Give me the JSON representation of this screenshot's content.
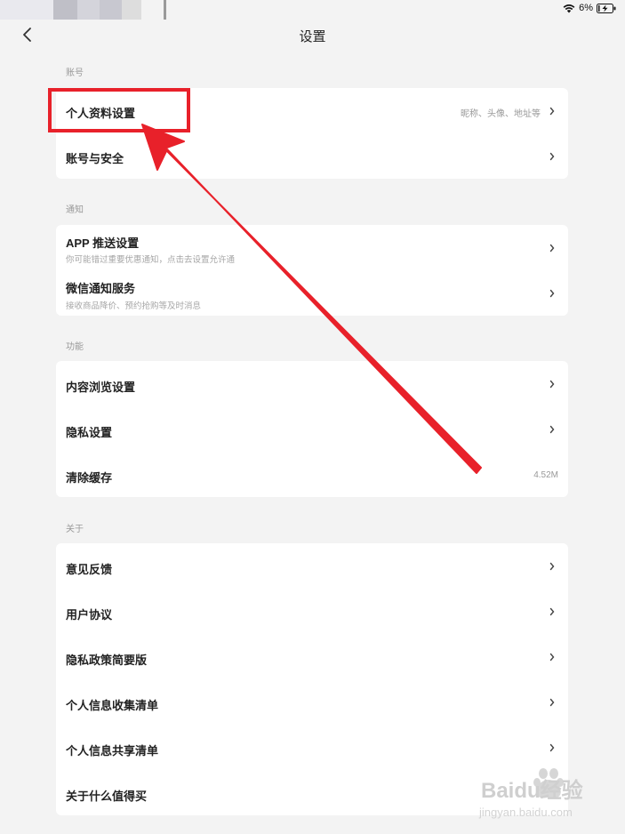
{
  "status_bar": {
    "battery_text": "6%",
    "icons": [
      "wifi-icon",
      "battery-charging-icon"
    ]
  },
  "nav": {
    "title": "设置",
    "back_icon": "chevron-left-icon"
  },
  "sections": [
    {
      "label": "账号",
      "rows": [
        {
          "title": "个人资料设置",
          "hint": "昵称、头像、地址等"
        },
        {
          "title": "账号与安全"
        }
      ]
    },
    {
      "label": "通知",
      "rows": [
        {
          "title": "APP 推送设置",
          "subtitle": "你可能错过重要优惠通知，点击去设置允许通"
        },
        {
          "title": "微信通知服务",
          "subtitle": "接收商品降价、预约抢购等及时消息"
        }
      ]
    },
    {
      "label": "功能",
      "rows": [
        {
          "title": "内容浏览设置"
        },
        {
          "title": "隐私设置"
        },
        {
          "title": "清除缓存",
          "hint": "4.52M"
        }
      ]
    },
    {
      "label": "关于",
      "rows": [
        {
          "title": "意见反馈"
        },
        {
          "title": "用户协议"
        },
        {
          "title": "隐私政策简要版"
        },
        {
          "title": "个人信息收集清单"
        },
        {
          "title": "个人信息共享清单"
        },
        {
          "title": "关于什么值得买"
        }
      ]
    }
  ],
  "watermark": {
    "brand": "Baidu经验",
    "url": "jingyan.baidu.com"
  },
  "colors": {
    "annotation_red": "#e8212a",
    "background": "#f3f3f3",
    "card": "#ffffff"
  }
}
